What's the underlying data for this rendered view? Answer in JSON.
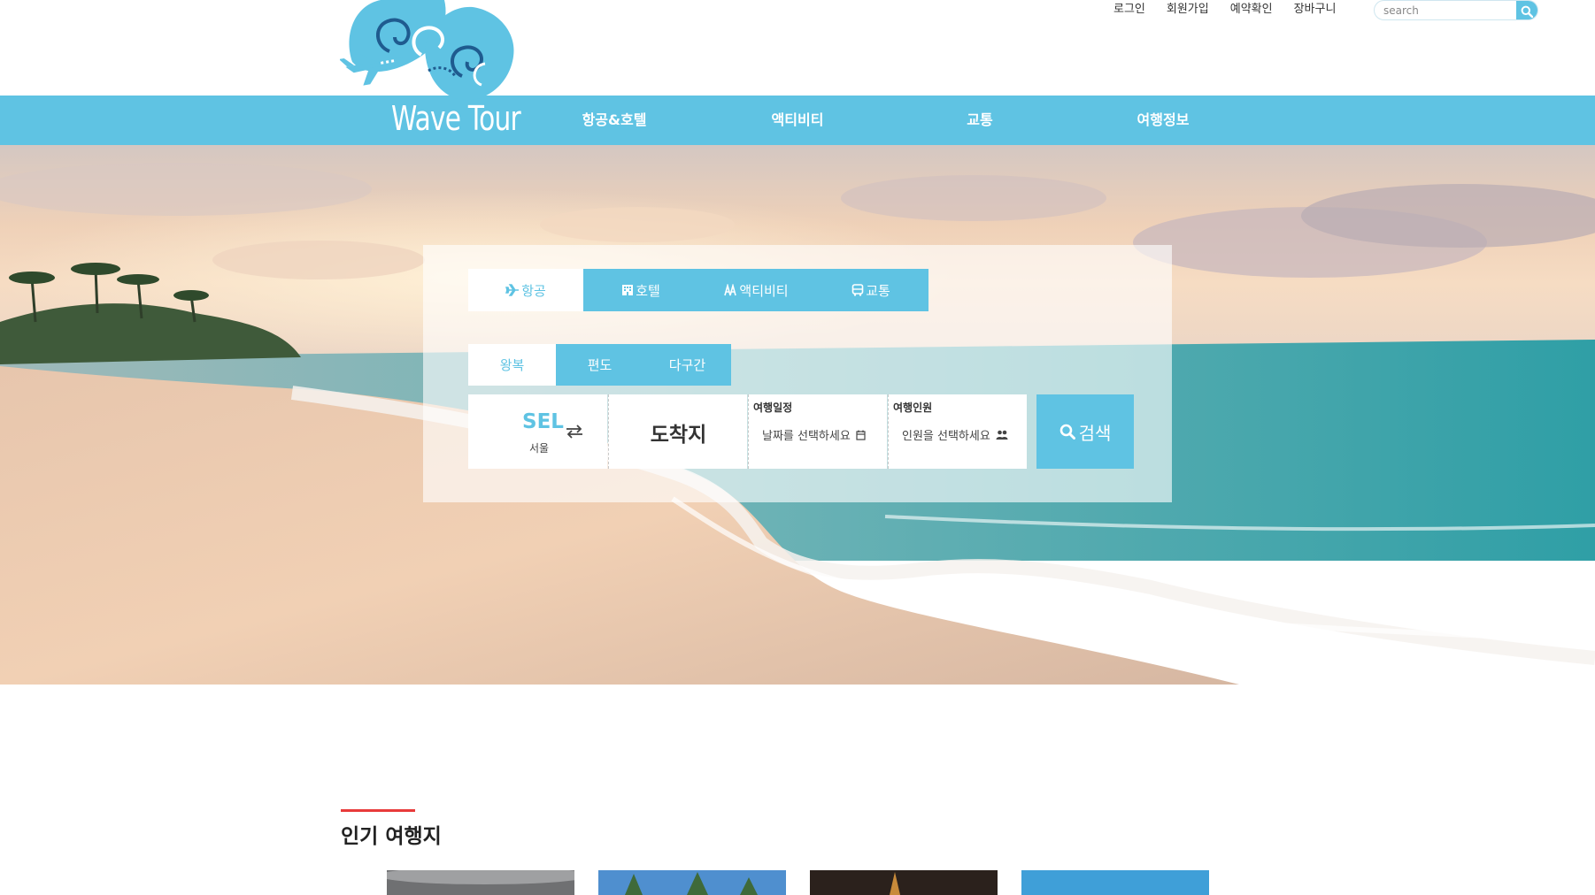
{
  "util_links": [
    "로그인",
    "회원가입",
    "예약확인",
    "장바구니"
  ],
  "search": {
    "placeholder": "search",
    "icon": "search-icon"
  },
  "brand": {
    "name": "Wave Tour"
  },
  "nav": [
    "항공&호텔",
    "액티비티",
    "교통",
    "여행정보"
  ],
  "booking": {
    "main_tabs": [
      {
        "label": "항공",
        "icon": "plane-icon",
        "active": true
      },
      {
        "label": "호텔",
        "icon": "hotel-icon",
        "active": false
      },
      {
        "label": "액티비티",
        "icon": "activity-icon",
        "active": false
      },
      {
        "label": "교통",
        "icon": "bus-icon",
        "active": false
      }
    ],
    "trip_tabs": [
      {
        "label": "왕복",
        "active": true
      },
      {
        "label": "편도",
        "active": false
      },
      {
        "label": "다구간",
        "active": false
      }
    ],
    "origin": {
      "code": "SEL",
      "city": "서울"
    },
    "destination": "도착지",
    "date": {
      "label": "여행일정",
      "placeholder": "날짜를 선택하세요"
    },
    "people": {
      "label": "여행인원",
      "placeholder": "인원을 선택하세요"
    },
    "search_button": "검색"
  },
  "popular": {
    "title": "인기 여행지"
  },
  "colors": {
    "accent": "#5fc3e3",
    "section_bar": "#e83a3a"
  }
}
